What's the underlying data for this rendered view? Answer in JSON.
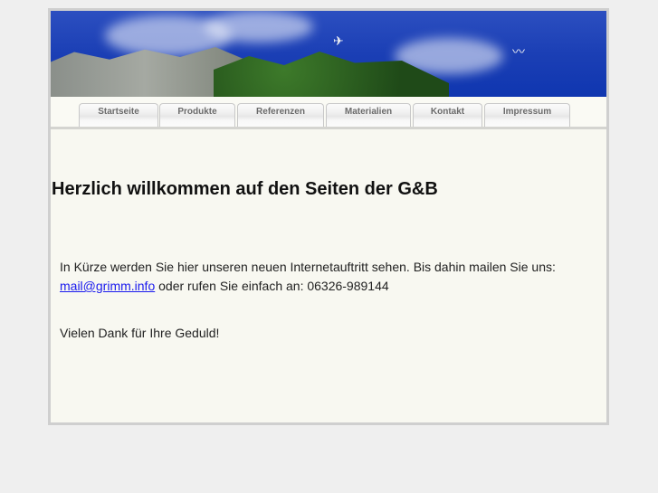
{
  "nav": {
    "tabs": [
      "Startseite",
      "Produkte",
      "Referenzen",
      "Materialien",
      "Kontakt",
      "Impressum"
    ]
  },
  "main": {
    "title": "Herzlich willkommen auf den Seiten der G&B",
    "intro_text": "In Kürze werden Sie hier unseren neuen Internetauftritt sehen. Bis dahin mailen Sie uns:",
    "email": "mail@grimm.info",
    "phone_text": " oder rufen Sie einfach an: 06326-989144",
    "thanks": "Vielen Dank für Ihre Geduld!"
  }
}
